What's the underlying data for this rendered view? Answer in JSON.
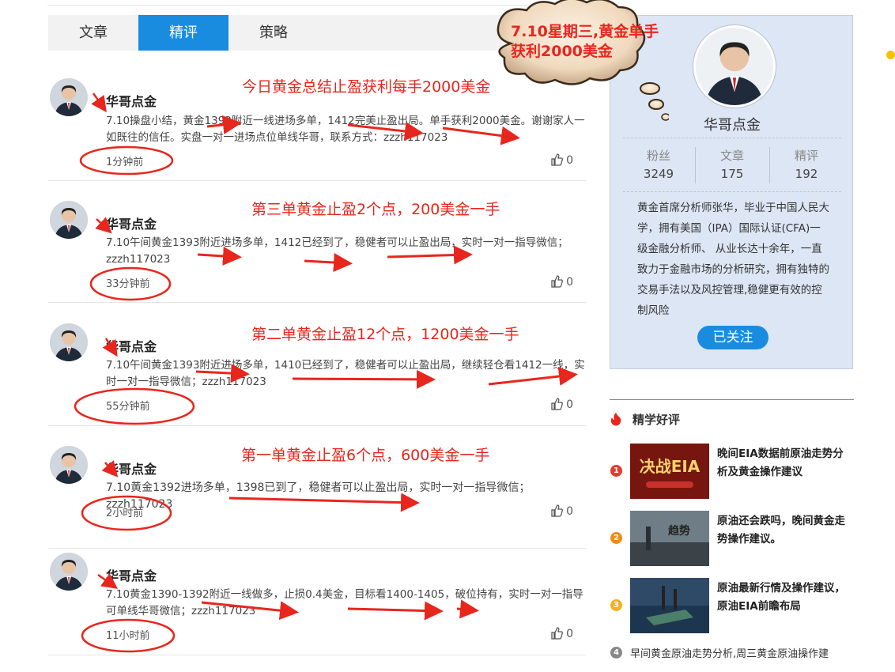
{
  "tabs": [
    "文章",
    "精评",
    "策略"
  ],
  "active_tab": 1,
  "posts": [
    {
      "author": "华哥点金",
      "content": "7.10操盘小结，黄金1392附近一线进场多单，1412完美止盈出局。单手获利2000美金。谢谢家人一如既往的信任。实盘一对一进场点位单线华哥，联系方式：zzzh117023",
      "time": "1分钟前",
      "likes": "0",
      "annotation": "今日黄金总结止盈获利每手2000美金"
    },
    {
      "author": "华哥点金",
      "content": "7.10午间黄金1393附近进场多单，1412已经到了，稳健者可以止盈出局，实时一对一指导微信；zzzh117023",
      "time": "33分钟前",
      "likes": "0",
      "annotation": "第三单黄金止盈2个点，200美金一手"
    },
    {
      "author": "华哥点金",
      "content": "7.10午间黄金1393附近进场多单，1410已经到了，稳健者可以止盈出局，继续轻仓看1412一线，实时一对一指导微信；zzzh117023",
      "time": "55分钟前",
      "likes": "0",
      "annotation": "第二单黄金止盈12个点，1200美金一手"
    },
    {
      "author": "华哥点金",
      "content": "7.10黄金1392进场多单，1398已到了，稳健者可以止盈出局，实时一对一指导微信；zzzh117023",
      "time": "2小时前",
      "likes": "0",
      "annotation": "第一单黄金止盈6个点，600美金一手"
    },
    {
      "author": "华哥点金",
      "content": "7.10黄金1390-1392附近一线做多，止损0.4美金，目标看1400-1405，破位持有，实时一对一指导可单线华哥微信；zzzh117023",
      "time": "11小时前",
      "likes": "0",
      "annotation": ""
    }
  ],
  "cloud_text": "7.10星期三,黄金单手获利2000美金",
  "profile": {
    "name": "华哥点金",
    "stats": [
      {
        "label": "粉丝",
        "value": "3249"
      },
      {
        "label": "文章",
        "value": "175"
      },
      {
        "label": "精评",
        "value": "192"
      }
    ],
    "bio": "黄金首席分析师张华，毕业于中国人民大学，拥有美国（IPA）国际认证(CFA)一级金融分析师、 从业长达十余年，一直致力于金融市场的分析研究，拥有独特的交易手法以及风控管理,稳健更有效的控制风险",
    "follow_label": "已关注"
  },
  "picks": {
    "title": "精学好评",
    "items": [
      {
        "num": "1",
        "title": "晚间EIA数据前原油走势分析及黄金操作建议",
        "color": "#e63a2e",
        "thumb_text": "决战EIA"
      },
      {
        "num": "2",
        "title": "原油还会跌吗，晚间黄金走势操作建议。",
        "color": "#f08a1e",
        "thumb_text": "趋势"
      },
      {
        "num": "3",
        "title": "原油最新行情及操作建议，原油EIA前瞻布局",
        "color": "#f5b21a",
        "thumb_text": ""
      },
      {
        "num": "4",
        "title": "早间黄金原油走势分析,周三黄金原油操作建",
        "color": "#888888",
        "thumb_text": ""
      }
    ]
  },
  "colors": {
    "accent": "#1a8ce0",
    "annotation": "#e8261d"
  }
}
